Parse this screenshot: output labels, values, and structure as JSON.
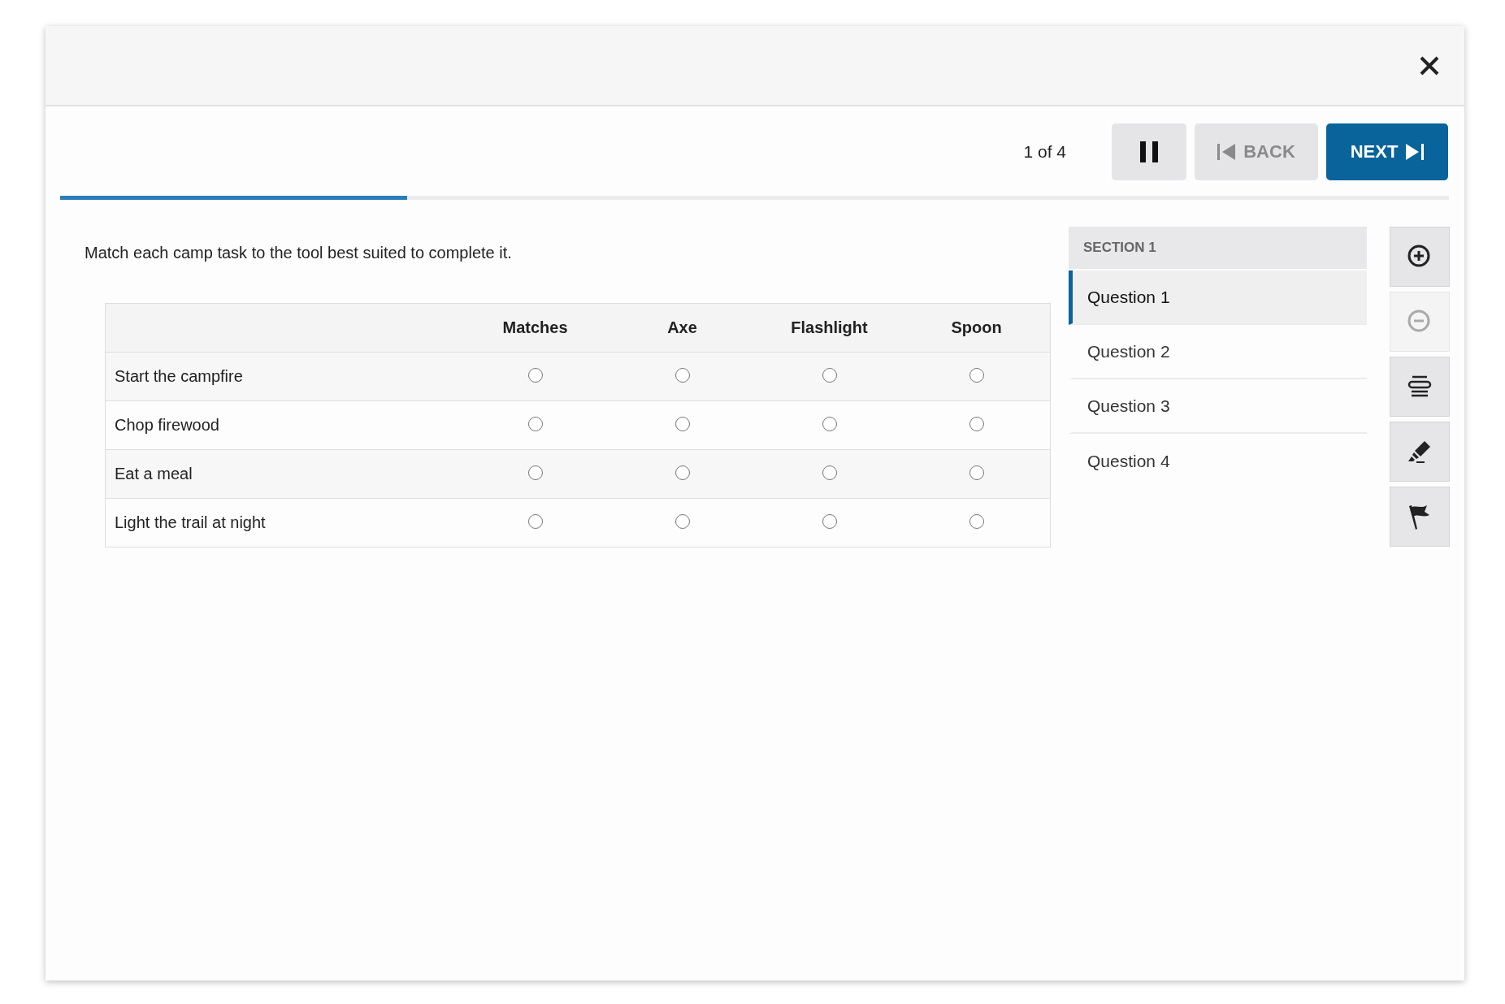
{
  "counter": "1 of 4",
  "buttons": {
    "pause": {
      "disabled": false
    },
    "back": {
      "label": "BACK",
      "disabled": true
    },
    "next": {
      "label": "NEXT",
      "disabled": false
    }
  },
  "progress": {
    "level": 0.25
  },
  "instruction": "Match each camp task to the tool best suited to complete it.",
  "table": {
    "columns": [
      "Matches",
      "Axe",
      "Flashlight",
      "Spoon"
    ],
    "rows": [
      {
        "label": "Start the campfire",
        "choices": [
          {
            "selected": false
          },
          {
            "selected": false
          },
          {
            "selected": false
          },
          {
            "selected": false
          }
        ]
      },
      {
        "label": "Chop firewood",
        "choices": [
          {
            "selected": false
          },
          {
            "selected": false
          },
          {
            "selected": false
          },
          {
            "selected": false
          }
        ]
      },
      {
        "label": "Eat a meal",
        "choices": [
          {
            "selected": false
          },
          {
            "selected": false
          },
          {
            "selected": false
          },
          {
            "selected": false
          }
        ]
      },
      {
        "label": "Light the trail at night",
        "choices": [
          {
            "selected": false
          },
          {
            "selected": false
          },
          {
            "selected": false
          },
          {
            "selected": false
          }
        ]
      }
    ]
  },
  "sidebar": {
    "section": "SECTION 1",
    "items": [
      {
        "label": "Question 1",
        "selected": true
      },
      {
        "label": "Question 2",
        "selected": false
      },
      {
        "label": "Question 3",
        "selected": false
      },
      {
        "label": "Question 4",
        "selected": false
      }
    ]
  },
  "tools": [
    {
      "kind": "zoom-in",
      "disabled": false
    },
    {
      "kind": "zoom-out",
      "disabled": true
    },
    {
      "kind": "line-reader",
      "disabled": false
    },
    {
      "kind": "highlighter",
      "disabled": false
    },
    {
      "kind": "flag",
      "disabled": false
    }
  ]
}
